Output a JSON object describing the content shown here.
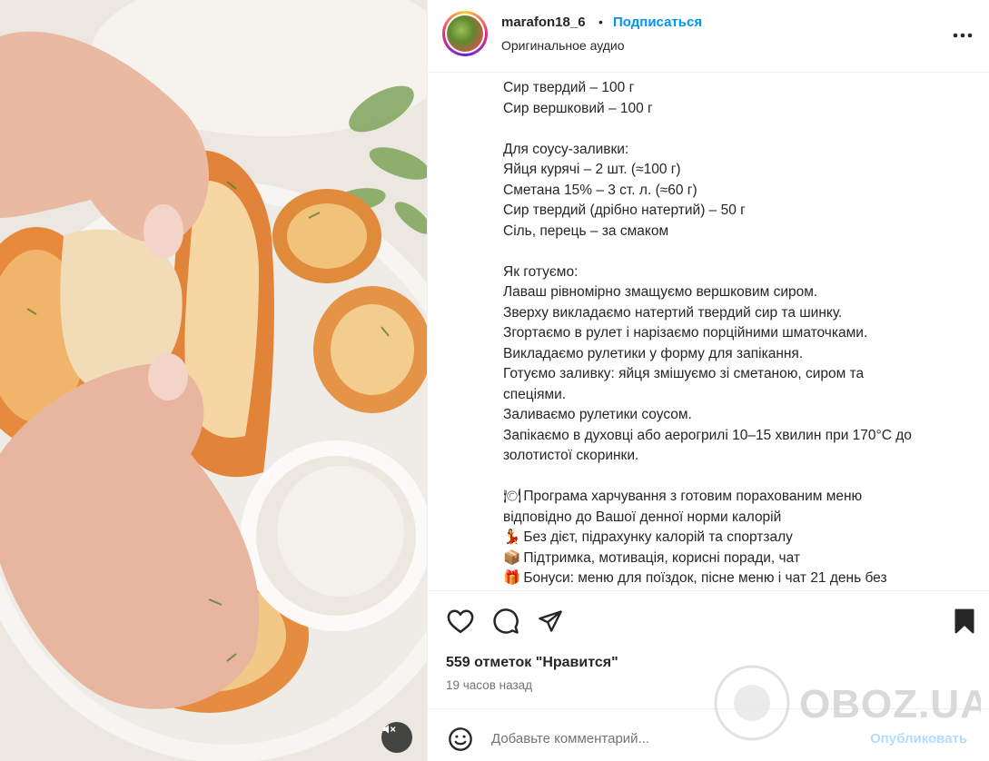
{
  "header": {
    "username": "marafon18_6",
    "separator": "•",
    "follow_label": "Подписаться",
    "audio_label": "Оригинальное аудио",
    "more_icon": "more-horizontal-icon"
  },
  "caption": {
    "lines": [
      "Сир твердий – 100 г",
      "Сир вершковий – 100 г",
      "",
      "Для соусу-заливки:",
      "Яйця курячі – 2 шт. (≈100 г)",
      "Сметана 15% – 3 ст. л. (≈60 г)",
      "Сир твердий (дрібно натертий) – 50 г",
      "Сіль, перець – за смаком",
      "",
      "Як готуємо:",
      "Лаваш рівномірно змащуємо вершковим сиром.",
      "Зверху викладаємо натертий твердий сир та шинку.",
      "Згортаємо в рулет і нарізаємо порційними шматочками.",
      "Викладаємо рулетики у форму для запікання.",
      "Готуємо заливку: яйця змішуємо зі сметаною, сиром та",
      "спеціями.",
      "Заливаємо рулетики соусом.",
      "Запікаємо в духовці або аерогрилі 10–15 хвилин при 170°C до",
      "золотистої скоринки.",
      ""
    ],
    "promo": [
      {
        "emoji": "🍽",
        "text": "Програма харчування з готовим порахованим меню"
      },
      {
        "emoji": "",
        "text": "відповідно до Вашої денної норми калорій"
      },
      {
        "emoji": "💃",
        "text": "Без дієт, підрахунку калорій та спортзалу"
      },
      {
        "emoji": "📦",
        "text": "Підтримка, мотивація, корисні поради, чат"
      },
      {
        "emoji": "🎁",
        "text": "Бонуси: меню для поїздок, пісне меню і чат 21 день без"
      }
    ]
  },
  "actions": {
    "likes": "559 отметок \"Нравится\"",
    "time": "19 часов назад"
  },
  "comment": {
    "placeholder": "Добавьте комментарий...",
    "publish_label": "Опубликовать"
  },
  "watermark": "OBOZ.UA",
  "colors": {
    "link_blue": "#0095f6",
    "publish_disabled": "#b3dbff",
    "text": "#262626",
    "muted": "#737373"
  }
}
